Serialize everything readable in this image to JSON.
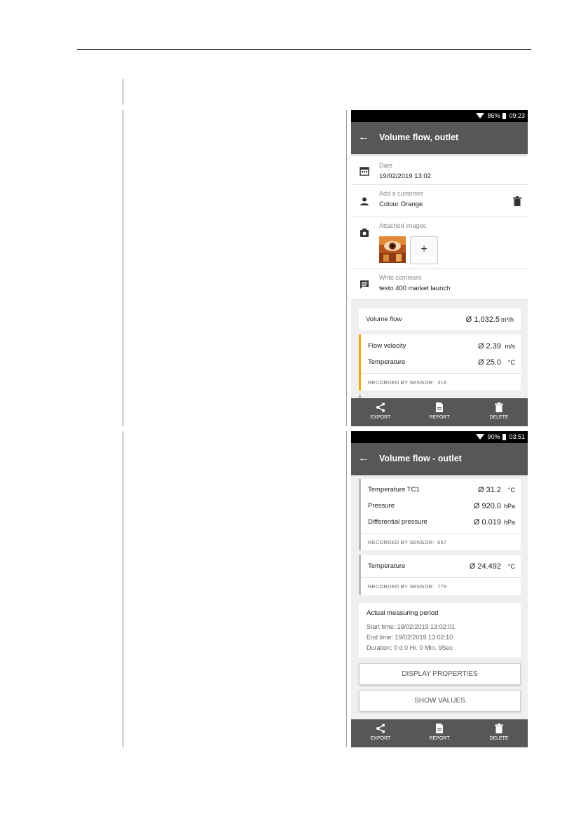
{
  "screen1": {
    "status": {
      "battery": "86%",
      "time": "09:23"
    },
    "title": "Volume flow, outlet",
    "date": {
      "label": "Date",
      "value": "19/02/2019 13:02"
    },
    "customer": {
      "label": "Add a customer",
      "value": "Colour Orange"
    },
    "images": {
      "label": "Attached images",
      "add_symbol": "+"
    },
    "comment": {
      "label": "Write comment",
      "value": "testo 400 market launch"
    },
    "volume_flow": {
      "label": "Volume flow",
      "value": "Ø 1,032.5",
      "unit": "m³/h"
    },
    "sensor_card": {
      "rows": [
        {
          "label": "Flow velocity",
          "value": "Ø 2.39",
          "unit": "m/s"
        },
        {
          "label": "Temperature",
          "value": "Ø 25.0",
          "unit": "°C"
        }
      ],
      "recorded": "RECORDED BY SENSOR:",
      "sensor_id": "318"
    },
    "bottom": {
      "export": "EXPORT",
      "report": "REPORT",
      "delete": "DELETE"
    }
  },
  "screen2": {
    "status": {
      "battery": "90%",
      "time": "03:51"
    },
    "title": "Volume flow - outlet",
    "card1": {
      "rows": [
        {
          "label": "Temperature TC1",
          "value": "Ø 31.2",
          "unit": "°C"
        },
        {
          "label": "Pressure",
          "value": "Ø 920.0",
          "unit": "hPa"
        },
        {
          "label": "Differential pressure",
          "value": "Ø 0.019",
          "unit": "hPa"
        }
      ],
      "recorded": "RECORDED BY SENSOR:",
      "sensor_id": "657"
    },
    "card2": {
      "rows": [
        {
          "label": "Temperature",
          "value": "Ø 24.492",
          "unit": "°C"
        }
      ],
      "recorded": "RECORDED BY SENSOR:",
      "sensor_id": "779"
    },
    "period": {
      "title": "Actual measuring period",
      "start": "Start time: 19/02/2019 13:02:01",
      "end": "End time: 19/02/2019 13:02:10",
      "duration": "Duration: 0 d 0 Hr. 0 Min. 9Sec"
    },
    "display_properties": "DISPLAY PROPERTIES",
    "show_values": "SHOW VALUES",
    "bottom": {
      "export": "EXPORT",
      "report": "REPORT",
      "delete": "DELETE"
    }
  },
  "colors": {
    "appbar": "#575757",
    "accent": "#f0a500",
    "status": "#000000"
  }
}
